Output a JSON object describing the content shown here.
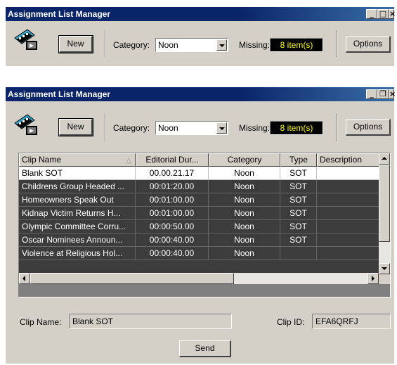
{
  "window1": {
    "title": "Assignment List Manager",
    "new_label": "New",
    "category_label": "Category:",
    "category_value": "Noon",
    "missing_label": "Missing:",
    "missing_value": "8 item(s)",
    "options_label": "Options",
    "controls": {
      "min": "_",
      "max": "□",
      "close": "×"
    }
  },
  "window2": {
    "title": "Assignment List Manager",
    "new_label": "New",
    "category_label": "Category:",
    "category_value": "Noon",
    "missing_label": "Missing:",
    "missing_value": "8 item(s)",
    "options_label": "Options",
    "controls": {
      "min": "_",
      "max": "❐",
      "close": "×"
    },
    "columns": [
      "Clip Name",
      "Editorial Dur...",
      "Category",
      "Type",
      "Description"
    ],
    "rows": [
      {
        "clip": "Blank SOT",
        "dur": "00.00.21.17",
        "category": "Noon",
        "type": "SOT",
        "desc": ""
      },
      {
        "clip": "Childrens Group Headed ...",
        "dur": "00:01:20.00",
        "category": "Noon",
        "type": "SOT",
        "desc": ""
      },
      {
        "clip": "Homeowners Speak Out",
        "dur": "00:01:00.00",
        "category": "Noon",
        "type": "SOT",
        "desc": ""
      },
      {
        "clip": "Kidnap Victim Returns H...",
        "dur": "00:01:00.00",
        "category": "Noon",
        "type": "SOT",
        "desc": ""
      },
      {
        "clip": "Olympic Committee Corru...",
        "dur": "00:00:50.00",
        "category": "Noon",
        "type": "SOT",
        "desc": ""
      },
      {
        "clip": "Oscar Nominees Announ...",
        "dur": "00:00:40.00",
        "category": "Noon",
        "type": "SOT",
        "desc": ""
      },
      {
        "clip": "Violence at Religious Hol...",
        "dur": "00:00:40.00",
        "category": "Noon",
        "type": "",
        "desc": ""
      }
    ],
    "clip_name_label": "Clip Name:",
    "clip_name_value": "Blank SOT",
    "clip_id_label": "Clip ID:",
    "clip_id_value": "EFA6QRFJ",
    "send_label": "Send"
  },
  "colors": {
    "title_bar": "#0a246a",
    "selected_row": "#ffffff",
    "other_rows": "#3c3c3c",
    "missing_bg": "#000000",
    "missing_text": "#ffff00"
  }
}
